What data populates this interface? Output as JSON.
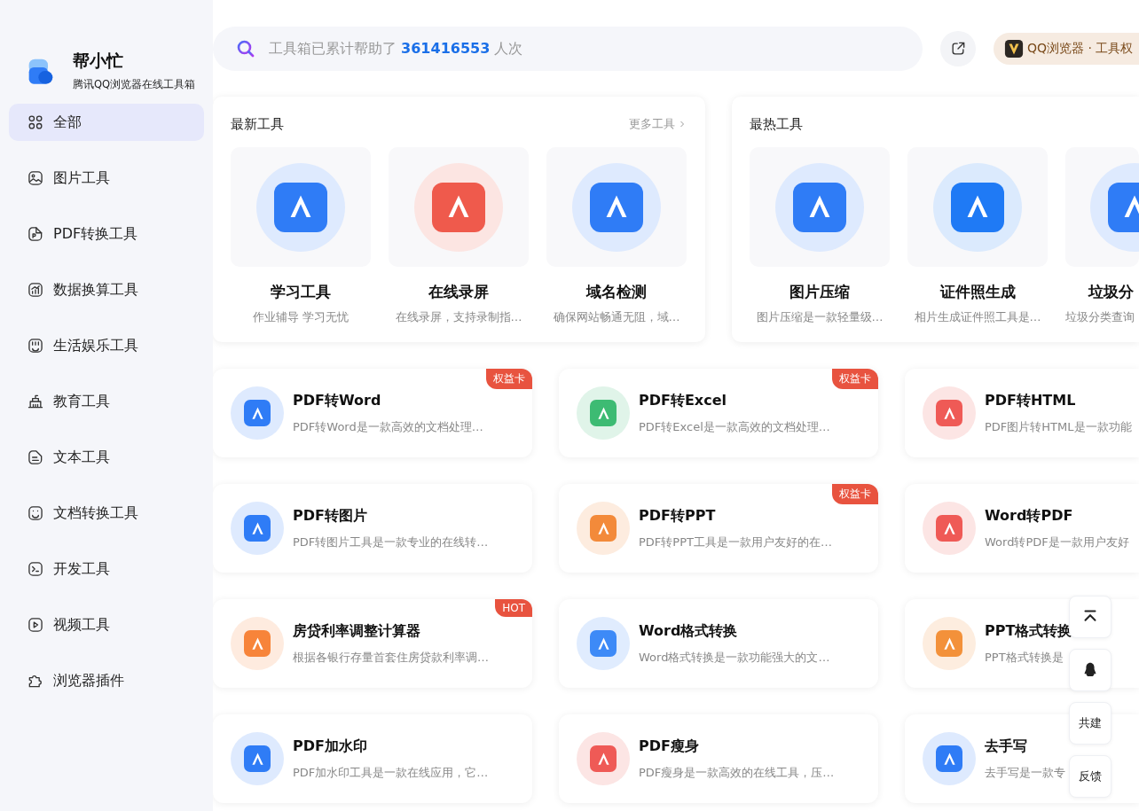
{
  "sidebar": {
    "brand": {
      "title": "帮小忙",
      "subtitle": "腾讯QQ浏览器在线工具箱"
    },
    "items": [
      {
        "label": "全部",
        "kind": "grid",
        "selected": true
      },
      {
        "label": "图片工具",
        "kind": "image",
        "selected": false
      },
      {
        "label": "PDF转换工具",
        "kind": "pdf",
        "selected": false
      },
      {
        "label": "数据换算工具",
        "kind": "chart",
        "selected": false
      },
      {
        "label": "生活娱乐工具",
        "kind": "life",
        "selected": false
      },
      {
        "label": "教育工具",
        "kind": "school",
        "selected": false
      },
      {
        "label": "文本工具",
        "kind": "text",
        "selected": false
      },
      {
        "label": "文档转换工具",
        "kind": "doc",
        "selected": false
      },
      {
        "label": "开发工具",
        "kind": "code",
        "selected": false
      },
      {
        "label": "视频工具",
        "kind": "video",
        "selected": false
      },
      {
        "label": "浏览器插件",
        "kind": "puzzle",
        "selected": false
      }
    ]
  },
  "search": {
    "text": "工具箱已累计帮助了 **361416553** 人次"
  },
  "promo": {
    "label": "QQ浏览器 · 工具权"
  },
  "panels": [
    {
      "title": "最新工具",
      "more": "更多工具",
      "tools": [
        {
          "name": "学习工具",
          "desc": "作业辅导 学习无忧",
          "color": "#2f7cf6"
        },
        {
          "name": "在线录屏",
          "desc": "在线录屏，支持录制指…",
          "color": "#ef5a4c"
        },
        {
          "name": "域名检测",
          "desc": "确保网站畅通无阻，域…",
          "color": "#2f7cf6"
        }
      ]
    },
    {
      "title": "最热工具",
      "tools": [
        {
          "name": "图片压缩",
          "desc": "图片压缩是一款轻量级…",
          "color": "#2f7cf6"
        },
        {
          "name": "证件照生成",
          "desc": "相片生成证件照工具是…",
          "color": "#1f7af5"
        },
        {
          "name": "垃圾分",
          "desc": "垃圾分类查询",
          "color": "#2f7cf6"
        }
      ]
    }
  ],
  "tools": [
    {
      "name": "PDF转Word",
      "desc": "PDF转Word是一款高效的文档处理…",
      "badge": "权益卡",
      "color": "#2f7cf6"
    },
    {
      "name": "PDF转Excel",
      "desc": "PDF转Excel是一款高效的文档处理…",
      "badge": "权益卡",
      "color": "#3dbb73"
    },
    {
      "name": "PDF转HTML",
      "desc": "PDF图片转HTML是一款功能",
      "color": "#ef5a56"
    },
    {
      "name": "PDF转图片",
      "desc": "PDF转图片工具是一款专业的在线转…",
      "color": "#2f7cf6"
    },
    {
      "name": "PDF转PPT",
      "desc": "PDF转PPT工具是一款用户友好的在…",
      "badge": "权益卡",
      "color": "#f38a3a"
    },
    {
      "name": "Word转PDF",
      "desc": "Word转PDF是一款用户友好",
      "color": "#ef5a56"
    },
    {
      "name": "房贷利率调整计算器",
      "desc": "根据各银行存量首套住房贷款利率调…",
      "badge": "HOT",
      "color": "#f7843a"
    },
    {
      "name": "Word格式转换",
      "desc": "Word格式转换是一款功能强大的文…",
      "color": "#3d8af7"
    },
    {
      "name": "PPT格式转换",
      "desc": "PPT格式转换是",
      "color": "#f3913a"
    },
    {
      "name": "PDF加水印",
      "desc": "PDF加水印工具是一款在线应用，它…",
      "color": "#2f7cf6"
    },
    {
      "name": "PDF瘦身",
      "desc": "PDF瘦身是一款高效的在线工具，压…",
      "color": "#ef5a56"
    },
    {
      "name": "去手写",
      "desc": "去手写是一款专",
      "color": "#2f7cf6"
    }
  ],
  "float_buttons": [
    {
      "kind": "top"
    },
    {
      "kind": "qq"
    },
    {
      "kind": "text",
      "label": "共建"
    },
    {
      "kind": "text",
      "label": "反馈"
    }
  ]
}
